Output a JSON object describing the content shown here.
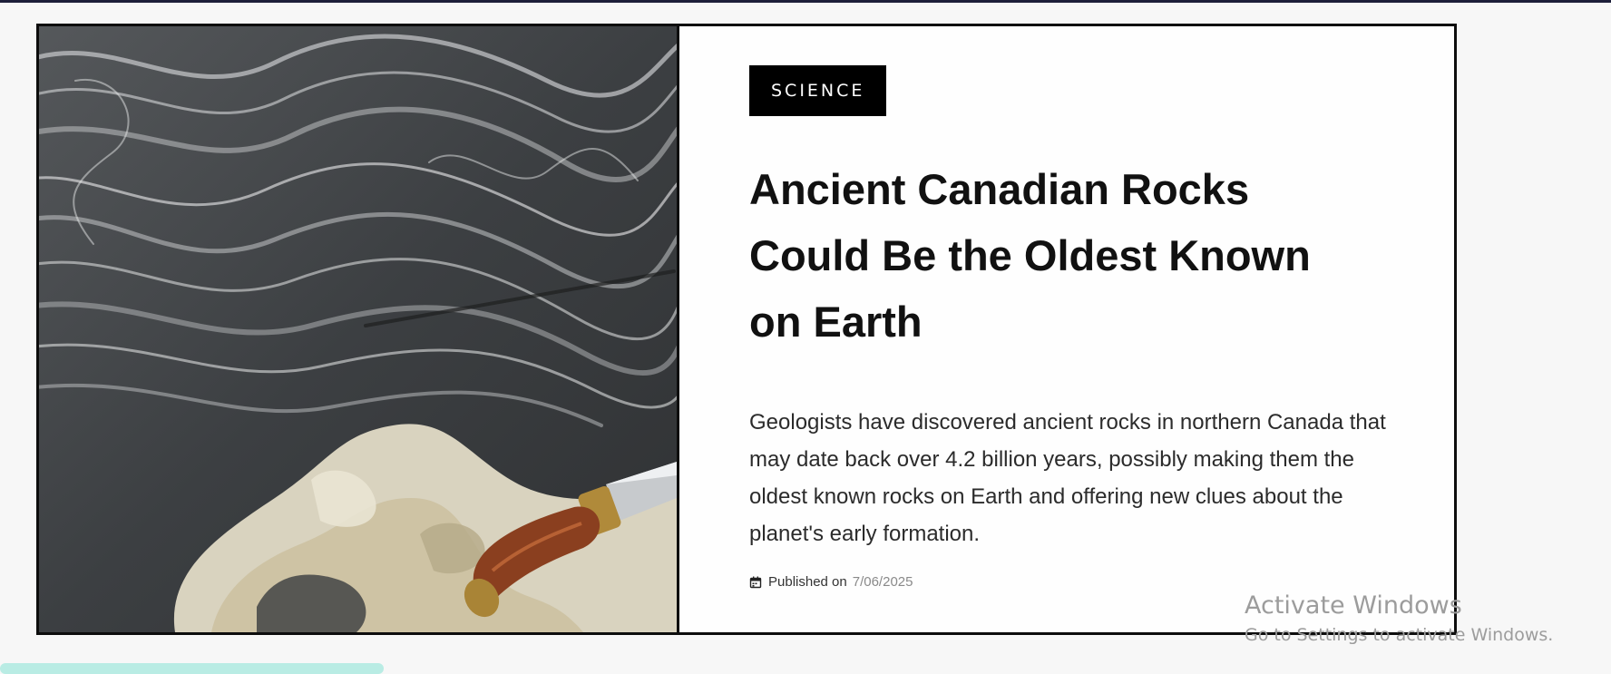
{
  "article": {
    "image_alt": "Gneiss rock formation with a knife for scale",
    "category": "SCIENCE",
    "title": "Ancient Canadian Rocks Could Be the Oldest Known on Earth",
    "description": "Geologists have discovered ancient rocks in northern Canada that may date back over 4.2 billion years, possibly making them the oldest known rocks on Earth and offering new clues about the planet's early formation.",
    "published_label": "Published on",
    "published_date": "7/06/2025",
    "published_icon": "calendar-icon"
  },
  "os_watermark": {
    "title": "Activate Windows",
    "subtitle": "Go to Settings to activate Windows."
  },
  "colors": {
    "tag_bg": "#000000",
    "card_border": "#0d0d0d",
    "title_text": "#111111",
    "date_text": "#8a8a8a",
    "bottom_accent": "#b9ece4"
  }
}
